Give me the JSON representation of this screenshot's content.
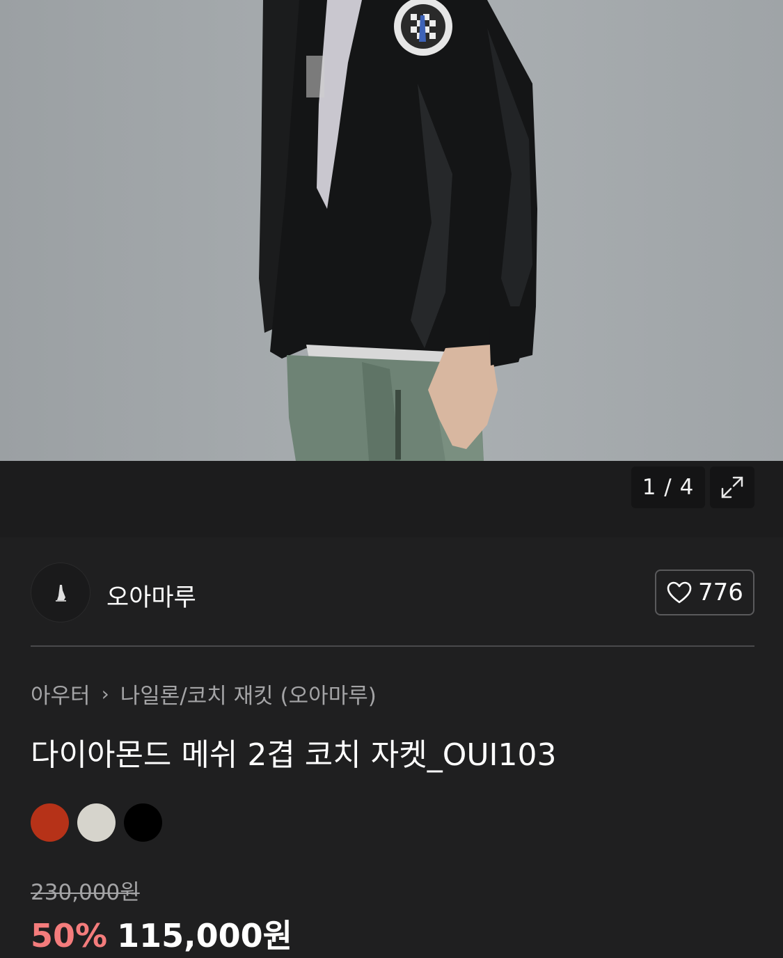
{
  "gallery": {
    "counter": "1 / 4",
    "image_alt": "product photo"
  },
  "brand": {
    "name": "오아마루",
    "like_count": "776"
  },
  "breadcrumb": {
    "category": "아우터",
    "separator": "›",
    "subcategory": "나일론/코치 재킷 (오아마루)"
  },
  "product": {
    "title": "다이아몬드 메쉬 2겹 코치 자켓_OUI103",
    "swatches": [
      {
        "name": "red",
        "color": "#b63218"
      },
      {
        "name": "ivory",
        "color": "#d6d4cc"
      },
      {
        "name": "black",
        "color": "#000000"
      }
    ],
    "original_price": "230,000원",
    "discount": "50%",
    "sale_price": "115,000원"
  },
  "colors": {
    "background": "#1f1f20",
    "discount": "#f47c7c",
    "muted_text": "#a4a4a6"
  }
}
